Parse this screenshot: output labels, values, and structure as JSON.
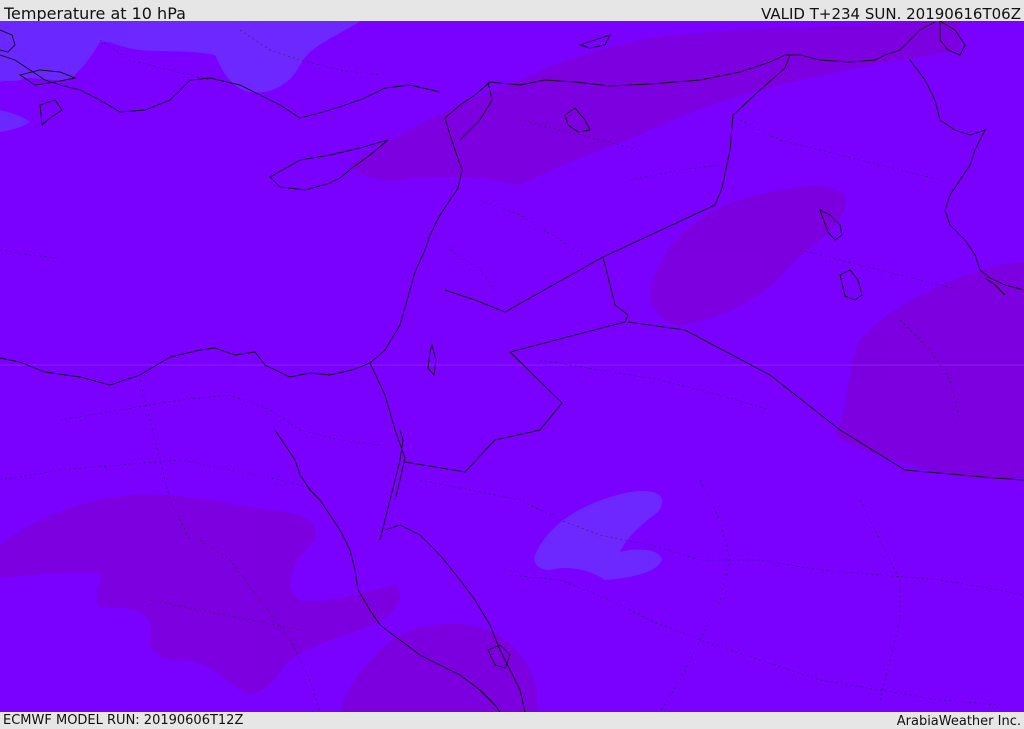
{
  "header": {
    "title": "Temperature at 10 hPa",
    "valid": "VALID T+234 SUN. 20190616T06Z"
  },
  "footer": {
    "model_run": "ECMWF MODEL RUN: 20190606T12Z",
    "credit": "ArabiaWeather Inc."
  },
  "colors": {
    "base": "#7a00ff",
    "warm": "#7d00de",
    "cool": "#6a2cff",
    "coast": "#111111",
    "border": "#1a1a1a"
  }
}
